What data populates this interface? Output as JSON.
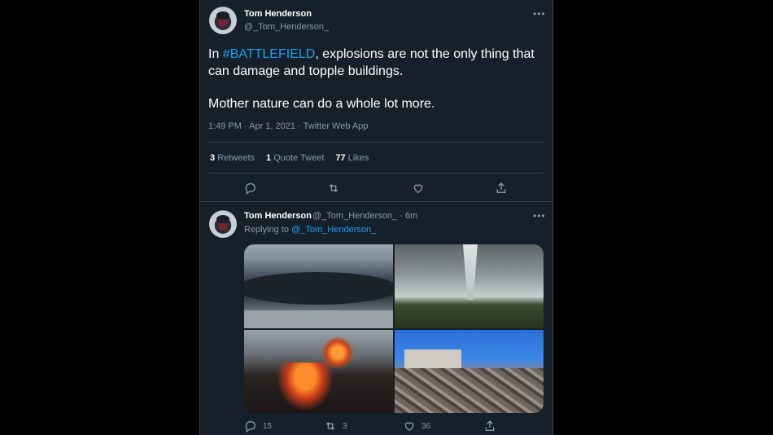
{
  "main_tweet": {
    "author_name": "Tom Henderson",
    "author_handle": "@_Tom_Henderson_",
    "more_label": "•••",
    "text_prefix": "In ",
    "hashtag": "#BATTLEFIELD",
    "text_suffix": ", explosions are not the only thing that can damage and topple buildings.",
    "text_line2": "Mother nature can do a whole lot more.",
    "meta": "1:49 PM · Apr 1, 2021 · Twitter Web App",
    "stats": [
      {
        "count": "3",
        "label": "Retweets"
      },
      {
        "count": "1",
        "label": "Quote Tweet"
      },
      {
        "count": "77",
        "label": "Likes"
      }
    ],
    "actions": [
      "reply-icon",
      "retweet-icon",
      "like-icon",
      "share-icon"
    ]
  },
  "reply_tweet": {
    "author_name": "Tom Henderson",
    "author_handle": "@_Tom_Henderson_",
    "time": "· 6m",
    "more_label": "•••",
    "replying_prefix": "Replying to ",
    "replying_handle": "@_Tom_Henderson_",
    "media": [
      "tsunami-image",
      "tornado-image",
      "volcano-image",
      "ruins-image"
    ],
    "reply_count": "15",
    "retweet_count": "3",
    "like_count": "36"
  },
  "colors": {
    "background": "#15202b",
    "accent": "#1da1f2",
    "muted": "#8899a6"
  }
}
